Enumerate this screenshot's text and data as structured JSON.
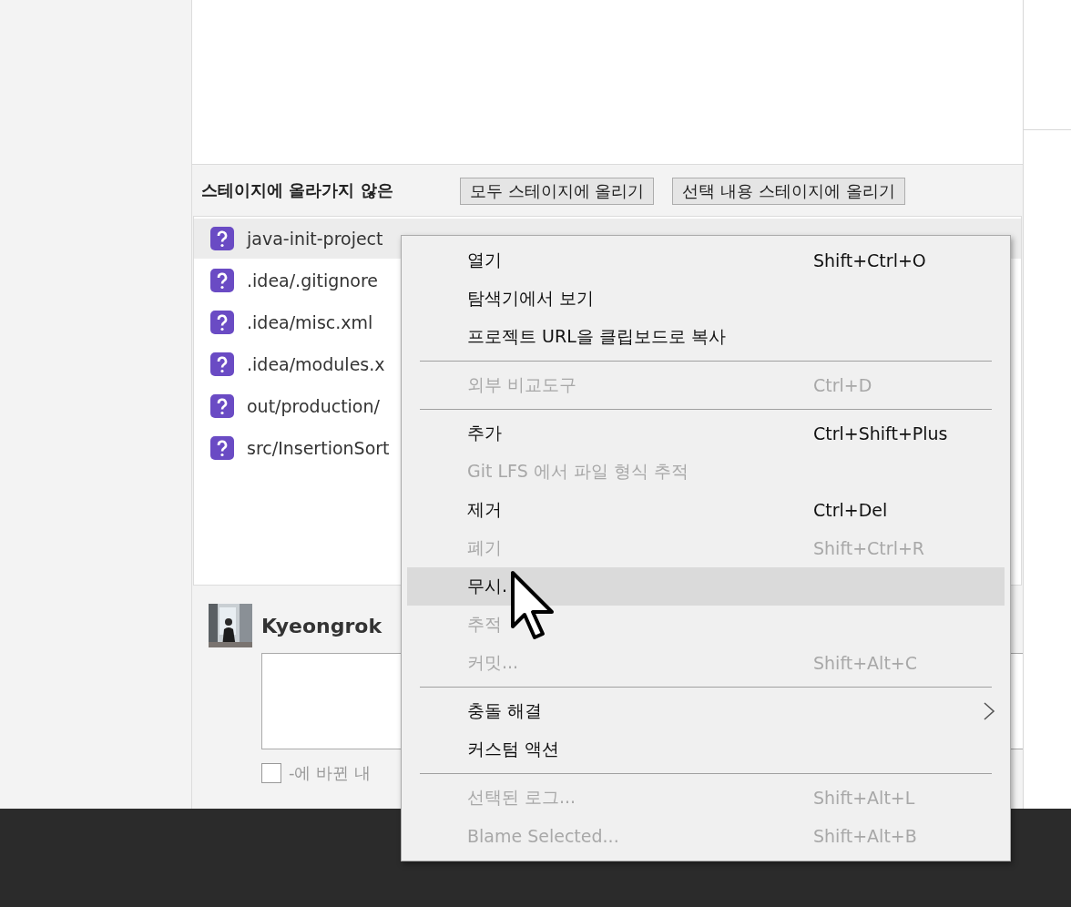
{
  "unstaged_header": {
    "label": "스테이지에 올라가지 않은",
    "buttons": [
      "모두 스테이지에 올리기",
      "선택 내용 스테이지에 올리기"
    ]
  },
  "files": [
    {
      "name": "java-init-project",
      "selected": true
    },
    {
      "name": ".idea/.gitignore",
      "selected": false
    },
    {
      "name": ".idea/misc.xml",
      "selected": false
    },
    {
      "name": ".idea/modules.x",
      "selected": false
    },
    {
      "name": "out/production/",
      "selected": false
    },
    {
      "name": "src/InsertionSort",
      "selected": false
    }
  ],
  "commit": {
    "author": "Kyeongrok",
    "checkbox": {
      "label": "-에 바뀐 내",
      "checked": false
    }
  },
  "context_menu": [
    {
      "kind": "item",
      "label": "열기",
      "shortcut": "Shift+Ctrl+O",
      "disabled": false,
      "selected": false
    },
    {
      "kind": "item",
      "label": "탐색기에서 보기",
      "disabled": false,
      "selected": false
    },
    {
      "kind": "item",
      "label": "프로젝트 URL을 클립보드로 복사",
      "disabled": false,
      "selected": false
    },
    {
      "kind": "separator"
    },
    {
      "kind": "item",
      "label": "외부 비교도구",
      "shortcut": "Ctrl+D",
      "disabled": true,
      "selected": false
    },
    {
      "kind": "separator"
    },
    {
      "kind": "item",
      "label": "추가",
      "shortcut": "Ctrl+Shift+Plus",
      "disabled": false,
      "selected": false
    },
    {
      "kind": "item",
      "label": "Git LFS 에서 파일 형식 추적",
      "disabled": true,
      "selected": false
    },
    {
      "kind": "item",
      "label": "제거",
      "shortcut": "Ctrl+Del",
      "disabled": false,
      "selected": false
    },
    {
      "kind": "item",
      "label": "폐기",
      "shortcut": "Shift+Ctrl+R",
      "disabled": true,
      "selected": false
    },
    {
      "kind": "item",
      "label": "무시.",
      "disabled": false,
      "selected": true
    },
    {
      "kind": "item",
      "label": "추적",
      "disabled": true,
      "selected": false
    },
    {
      "kind": "item",
      "label": "커밋...",
      "shortcut": "Shift+Alt+C",
      "disabled": true,
      "selected": false
    },
    {
      "kind": "separator"
    },
    {
      "kind": "submenu",
      "label": "충돌 해결",
      "disabled": false,
      "selected": false
    },
    {
      "kind": "item",
      "label": "커스텀 액션",
      "disabled": false,
      "selected": false
    },
    {
      "kind": "separator"
    },
    {
      "kind": "item",
      "label": "선택된 로그...",
      "shortcut": "Shift+Alt+L",
      "disabled": true,
      "selected": false
    },
    {
      "kind": "item",
      "label": "Blame Selected...",
      "shortcut": "Shift+Alt+B",
      "disabled": true,
      "selected": false
    }
  ]
}
